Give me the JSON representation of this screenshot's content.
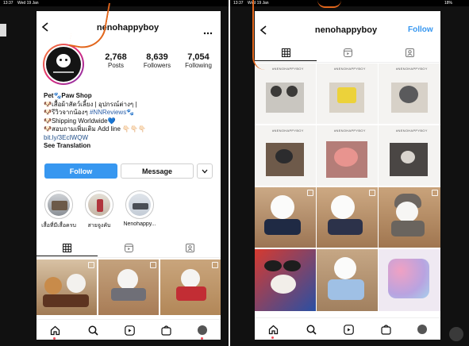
{
  "status_left": {
    "time": "13:37",
    "date": "Wed 19 Jan"
  },
  "status_right": {
    "time": "13:37",
    "date": "Wed 19 Jan",
    "battery": "18%"
  },
  "left": {
    "username": "nenohappyboy",
    "stats": [
      {
        "value": "2,768",
        "label": "Posts"
      },
      {
        "value": "8,639",
        "label": "Followers"
      },
      {
        "value": "7,054",
        "label": "Following"
      }
    ],
    "bio": {
      "name": "Pet🐾Paw Shop",
      "line1": "🐶เสื้อผ้าสัตว์เลี้ยง | อุปกรณ์ต่างๆ |",
      "line2_prefix": "🐶รีวิวจากน้องๆ ",
      "line2_tag": "#NNReviews",
      "line2_suffix": "🐾",
      "line3": "🐶Shipping Worldwide💙",
      "line4": "🐶สอบถามเพิ่มเติม Add line 👇🏻👇🏻👇🏻",
      "link": "bit.ly/3EcIWQW",
      "translate": "See Translation"
    },
    "buttons": {
      "follow": "Follow",
      "message": "Message"
    },
    "highlights": [
      {
        "label": "เสื้อที่มีเสื้อครบ"
      },
      {
        "label": "สายจูงคับ"
      },
      {
        "label": "Nenohappy..."
      }
    ]
  },
  "right": {
    "username": "nenohappyboy",
    "follow": "Follow",
    "grid_caption": "#NENOHAPPYBOY"
  },
  "icons": [
    "back-arrow-icon",
    "more-icon",
    "grid-icon",
    "reels-icon",
    "tagged-icon",
    "home-icon",
    "search-icon",
    "reels-nav-icon",
    "shop-icon",
    "profile-icon"
  ],
  "colors": {
    "accent": "#3797f0",
    "annotation": "#e2661c",
    "link": "#1f4e8a"
  }
}
